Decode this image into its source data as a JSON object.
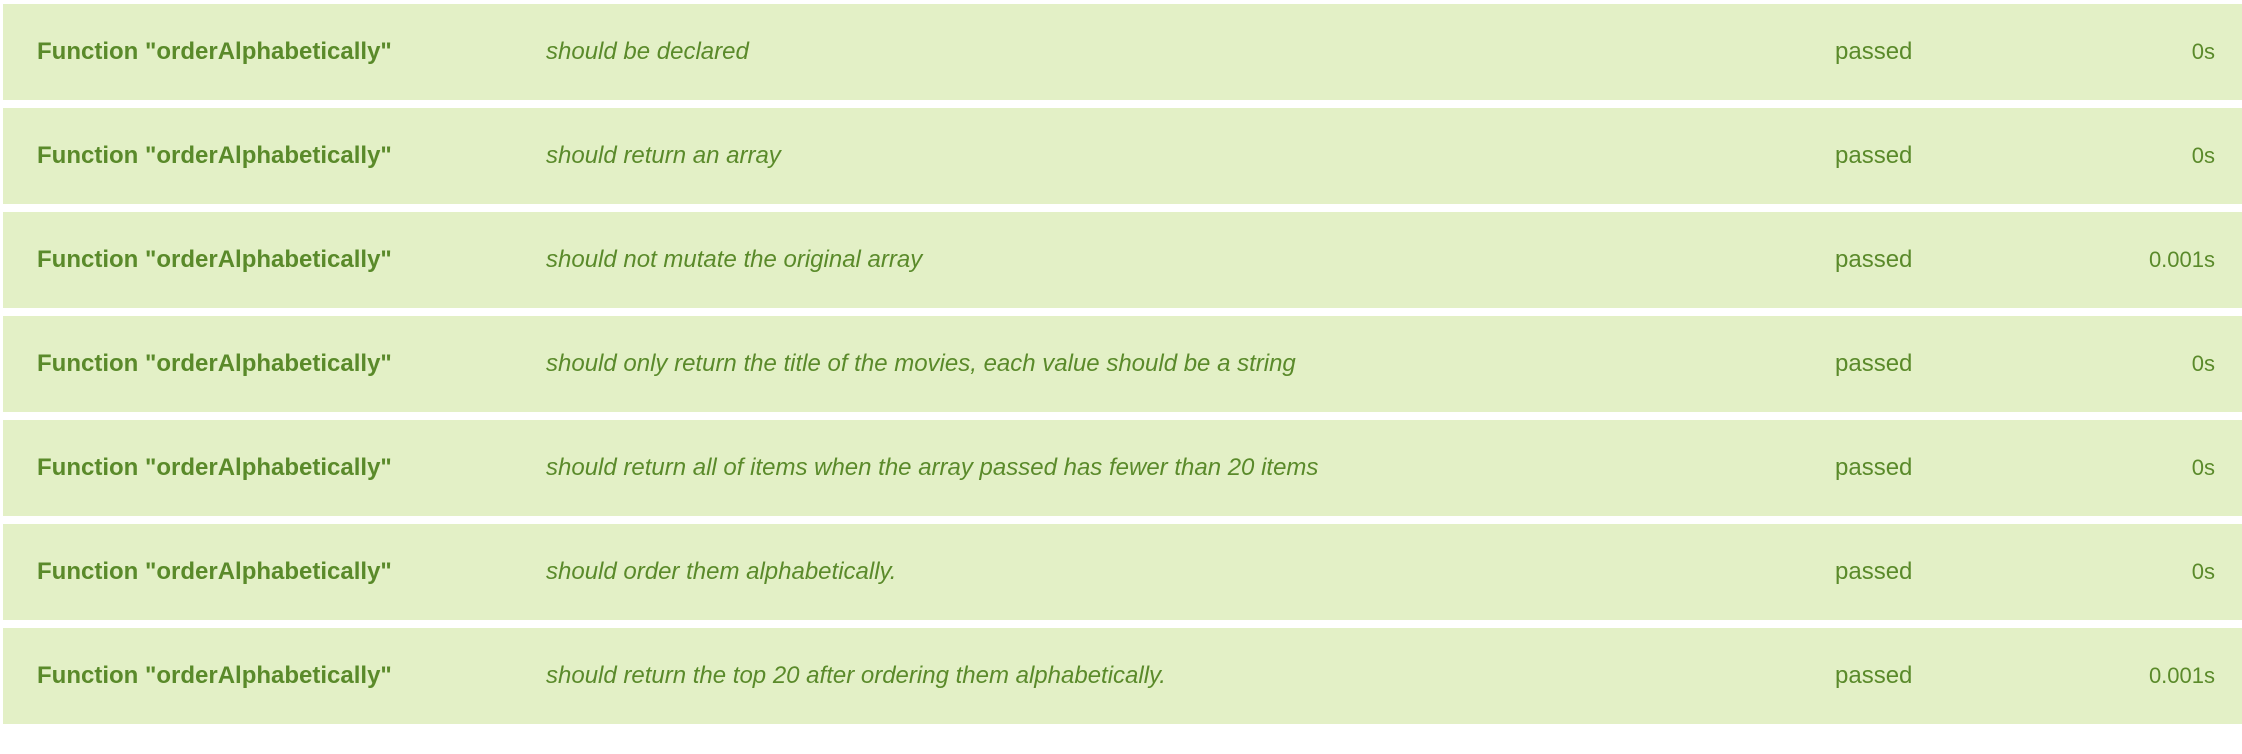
{
  "colors": {
    "row_background": "#e3f0c6",
    "text": "#5a8a2a"
  },
  "tests": [
    {
      "suite": "Function \"orderAlphabetically\"",
      "description": "should be declared",
      "status": "passed",
      "time": "0s"
    },
    {
      "suite": "Function \"orderAlphabetically\"",
      "description": "should return an array",
      "status": "passed",
      "time": "0s"
    },
    {
      "suite": "Function \"orderAlphabetically\"",
      "description": "should not mutate the original array",
      "status": "passed",
      "time": "0.001s"
    },
    {
      "suite": "Function \"orderAlphabetically\"",
      "description": "should only return the title of the movies, each value should be a string",
      "status": "passed",
      "time": "0s"
    },
    {
      "suite": "Function \"orderAlphabetically\"",
      "description": "should return all of items when the array passed has fewer than 20 items",
      "status": "passed",
      "time": "0s"
    },
    {
      "suite": "Function \"orderAlphabetically\"",
      "description": "should order them alphabetically.",
      "status": "passed",
      "time": "0s"
    },
    {
      "suite": "Function \"orderAlphabetically\"",
      "description": "should return the top 20 after ordering them alphabetically.",
      "status": "passed",
      "time": "0.001s"
    }
  ]
}
